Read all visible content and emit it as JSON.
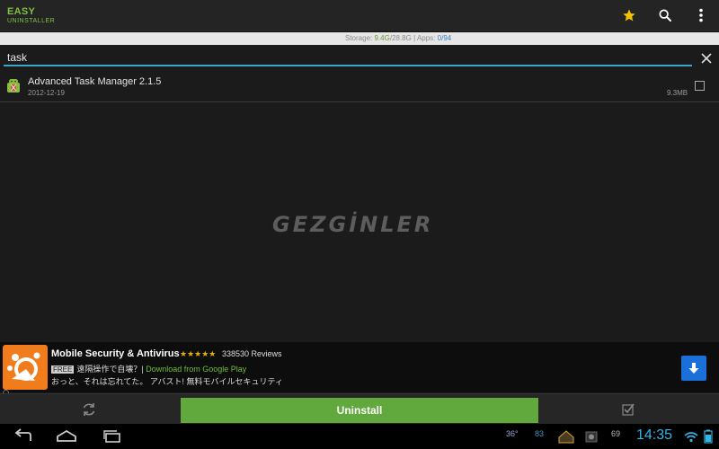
{
  "app": {
    "logo_main": "EASY",
    "logo_sub": "UNINSTALLER"
  },
  "actionbar": {
    "icons": [
      "star-icon",
      "search-icon",
      "overflow-menu-icon"
    ],
    "accent": "#7fc241"
  },
  "storage": {
    "label": "Storage:",
    "used": "9.4G",
    "total": "/28.8G",
    "separator": "|",
    "apps_label": "Apps:",
    "apps_selected": "0",
    "apps_total": "/94"
  },
  "search": {
    "value": "task",
    "underline_color": "#3aa6c9"
  },
  "list": {
    "items": [
      {
        "name": "Advanced Task Manager 2.1.5",
        "date": "2012-12-19",
        "size": "9.3MB",
        "checked": false,
        "icon": "android-app-icon"
      }
    ]
  },
  "watermark": "GEZGİNLER",
  "ad": {
    "title": "Mobile Security & Antivirus",
    "stars": "★★★★★",
    "rating": 4.5,
    "reviews": "338530 Reviews",
    "free_badge": "FREE",
    "subtitle": "遠隔操作で自壊？|",
    "source": "Download from Google Play",
    "description": "おっと、それは忘れてた。 アバスト! 無料モバイルセキュリティ",
    "icon": "avast-logo-icon"
  },
  "actions": {
    "uninstall_label": "Uninstall",
    "button_color": "#61a93c"
  },
  "statusbar": {
    "temp1": "36°",
    "signal": "83",
    "battery_pct": "69",
    "clock": "14:35",
    "clock_color": "#33b5e5"
  }
}
